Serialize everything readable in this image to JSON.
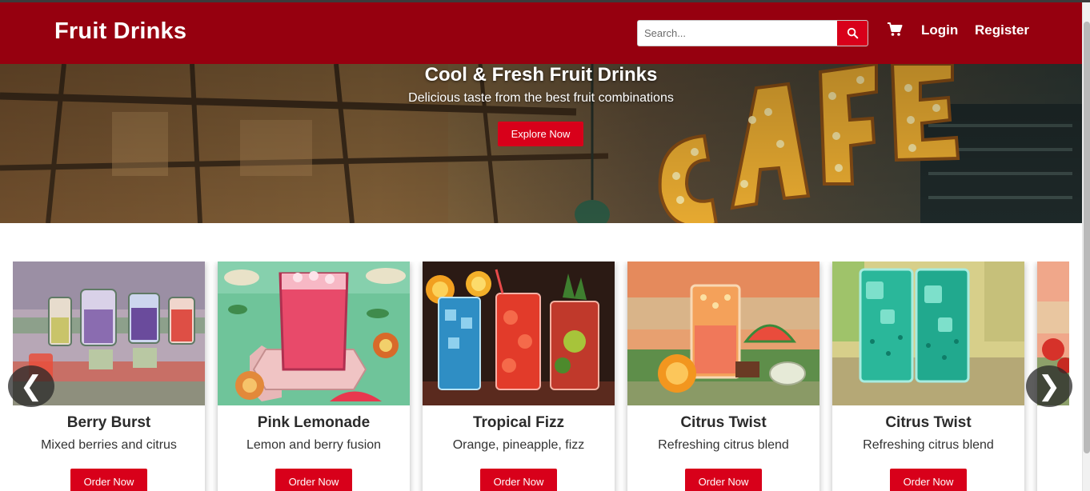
{
  "header": {
    "brand": "Fruit Drinks",
    "search_placeholder": "Search...",
    "nav": {
      "login": "Login",
      "register": "Register"
    }
  },
  "hero": {
    "title": "Cool & Fresh Fruit Drinks",
    "subtitle": "Delicious taste from the best fruit combinations",
    "button": "Explore Now"
  },
  "products": [
    {
      "name": "Berry Burst",
      "description": "Mixed berries and citrus",
      "button": "Order Now"
    },
    {
      "name": "Pink Lemonade",
      "description": "Lemon and berry fusion",
      "button": "Order Now"
    },
    {
      "name": "Tropical Fizz",
      "description": "Orange, pineapple, fizz",
      "button": "Order Now"
    },
    {
      "name": "Citrus Twist",
      "description": "Refreshing citrus blend",
      "button": "Order Now"
    },
    {
      "name": "Citrus Twist",
      "description": "Refreshing citrus blend",
      "button": "Order Now"
    }
  ],
  "carousel": {
    "prev_glyph": "❮",
    "next_glyph": "❯"
  },
  "icons": {
    "search": "search-icon",
    "cart": "cart-icon"
  },
  "colors": {
    "header_bg": "#96000f",
    "accent": "#d8001a",
    "text_dark": "#2b2b2b"
  }
}
